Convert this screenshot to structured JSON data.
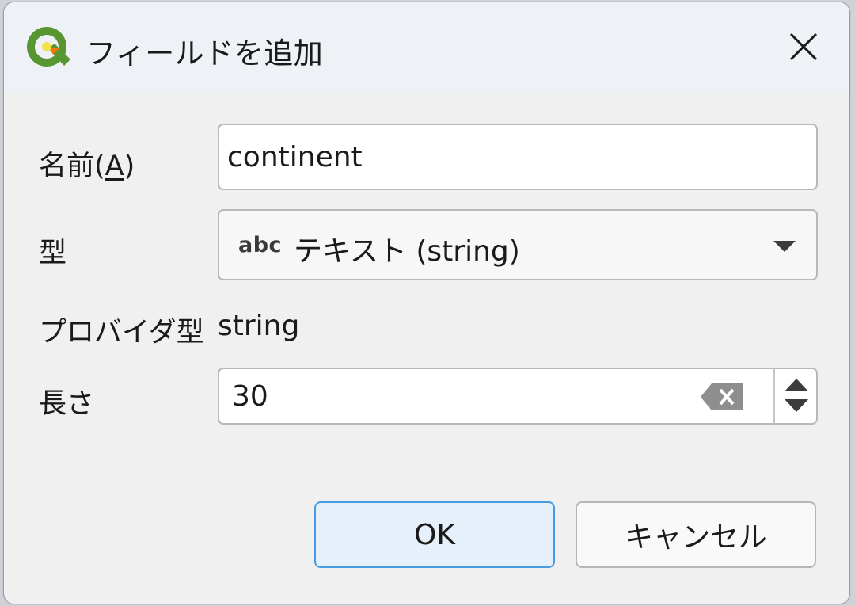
{
  "window": {
    "title": "フィールドを追加",
    "app_icon": "qgis-logo-icon",
    "close_icon": "close-icon"
  },
  "form": {
    "name_label_prefix": "名前(",
    "name_label_mnemonic": "A",
    "name_label_suffix": ")",
    "name_value": "continent",
    "type_label": "型",
    "type_icon_text": "abc",
    "type_value": "テキスト (string)",
    "provider_type_label": "プロバイダ型",
    "provider_type_value": "string",
    "length_label": "長さ",
    "length_value": "30"
  },
  "buttons": {
    "ok_label": "OK",
    "cancel_label": "キャンセル"
  },
  "colors": {
    "accent_border": "#4a9ae0",
    "qgis_green": "#589632",
    "qgis_yellow": "#ee7913"
  }
}
